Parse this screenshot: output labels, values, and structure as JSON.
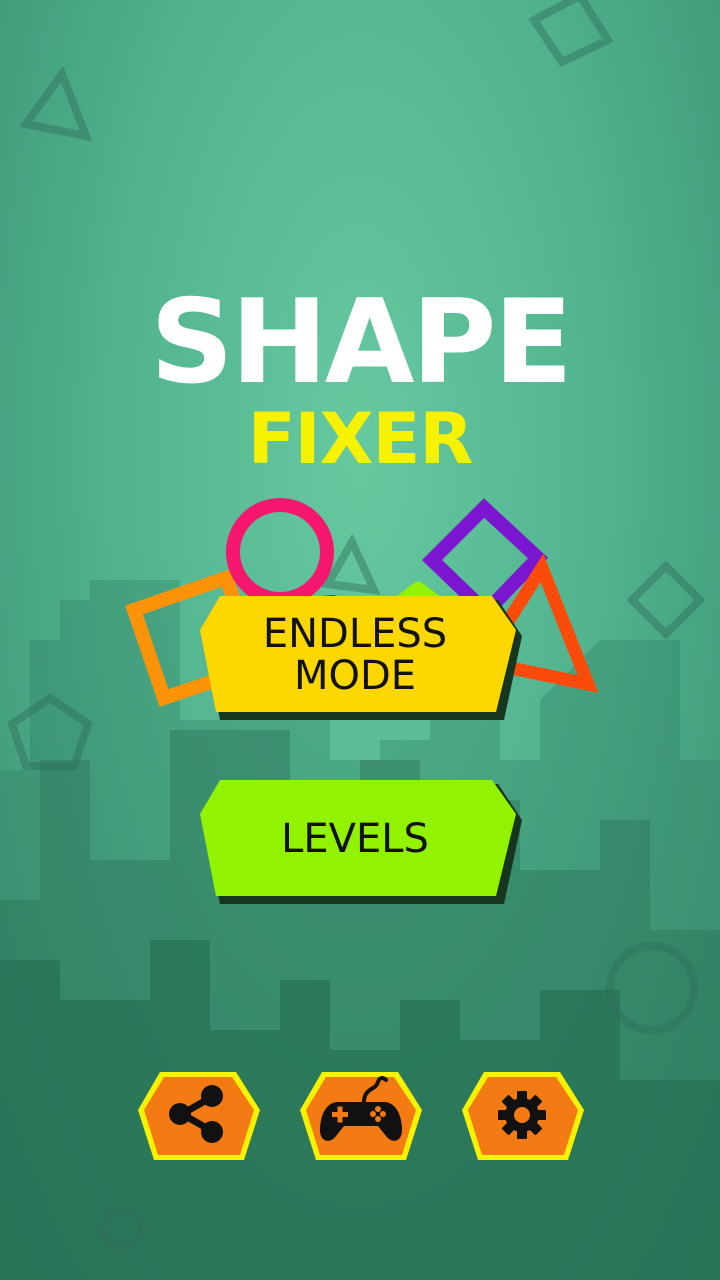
{
  "title": {
    "main": "SHAPE",
    "sub": "FIXER"
  },
  "menu": {
    "endless_label": "ENDLESS\nMODE",
    "levels_label": "LEVELS"
  },
  "bottom_icons": [
    {
      "icon": "share-icon"
    },
    {
      "icon": "gamepad-icon"
    },
    {
      "icon": "gear-icon"
    }
  ],
  "colors": {
    "endless_button": "#fdd700",
    "levels_button": "#92f300",
    "icon_button": "#f47b13",
    "icon_button_border": "#f6f200",
    "title_main": "#ffffff",
    "title_sub": "#f6f200"
  }
}
